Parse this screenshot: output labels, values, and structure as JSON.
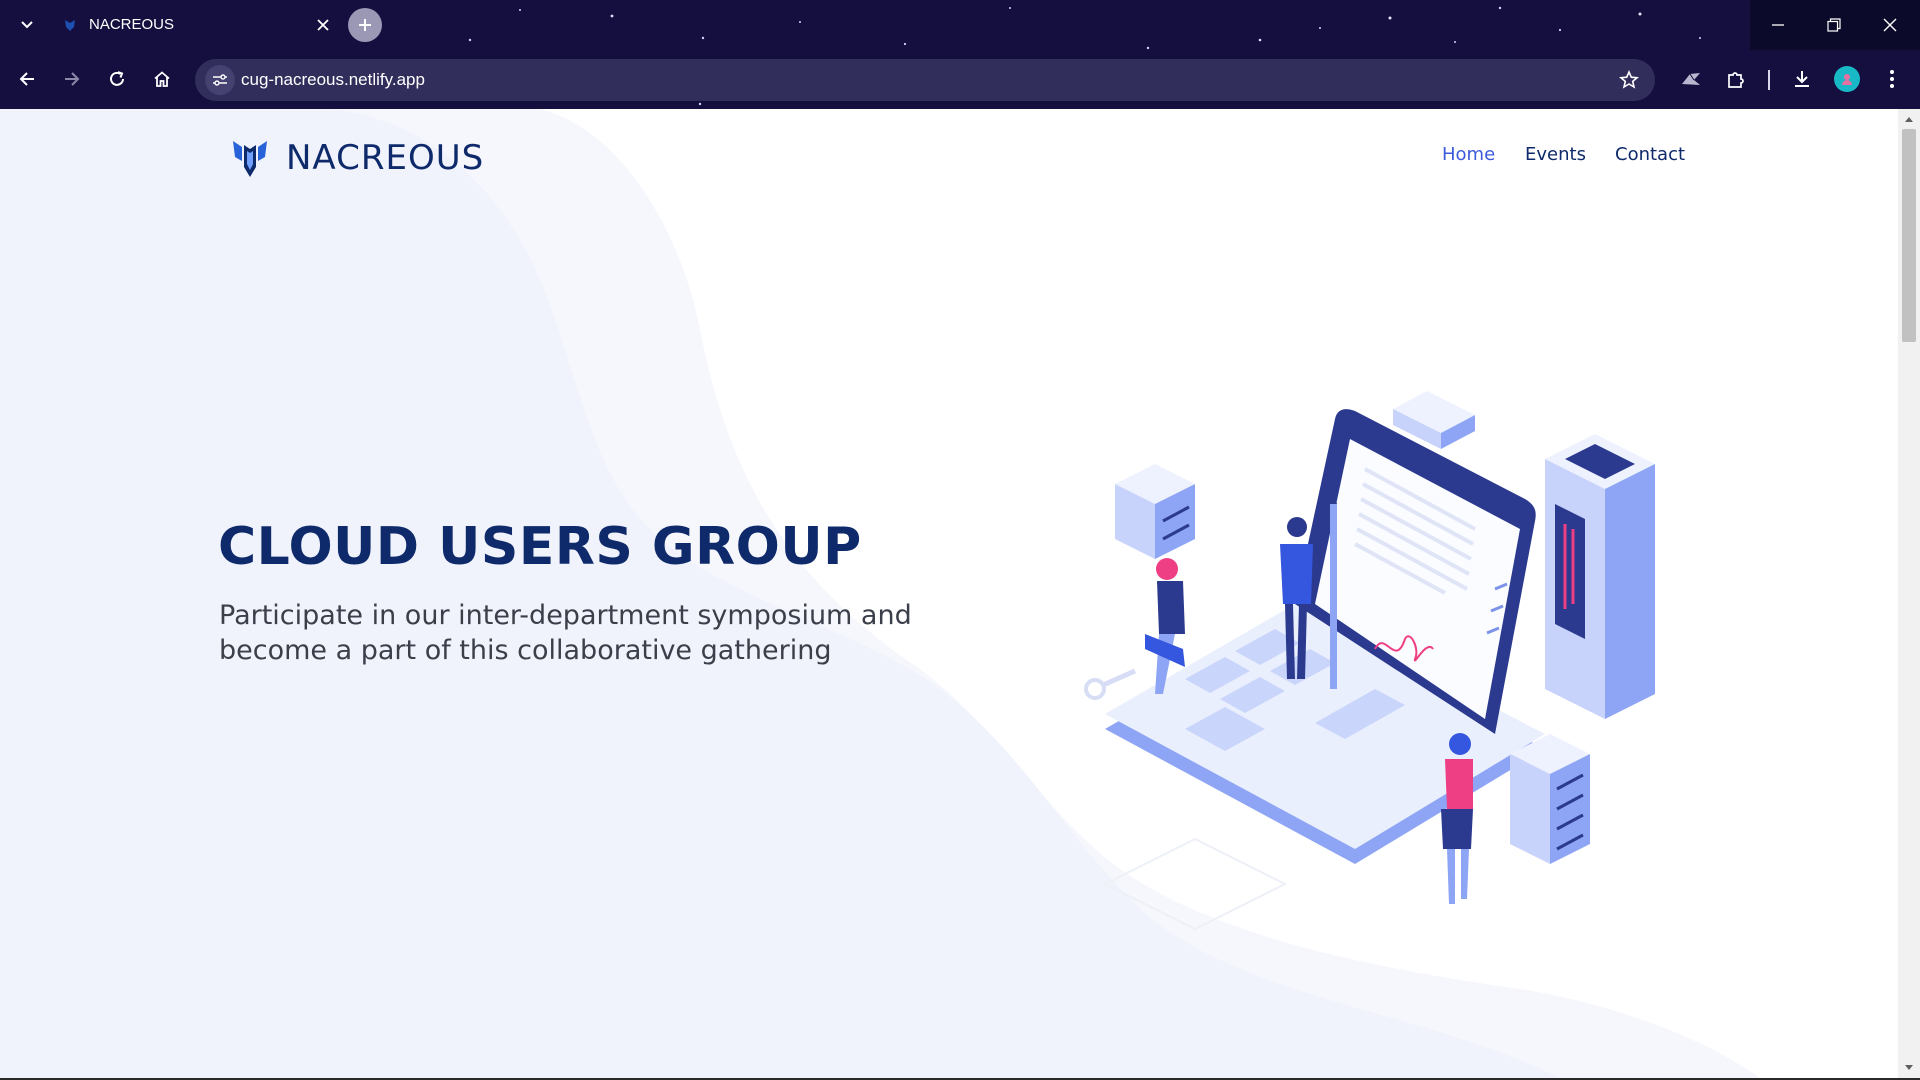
{
  "browser": {
    "tab_title": "NACREOUS",
    "url": "cug-nacreous.netlify.app",
    "colors": {
      "chrome_bg": "#140f3f",
      "omnibox_bg": "#322e5c",
      "profile": "#19b8c6"
    }
  },
  "site": {
    "brand": "NACREOUS",
    "nav": [
      {
        "label": "Home",
        "active": true
      },
      {
        "label": "Events",
        "active": false
      },
      {
        "label": "Contact",
        "active": false
      }
    ],
    "hero": {
      "title": "CLOUD USERS GROUP",
      "subtitle": "Participate in our inter-department symposium and become a part of this collaborative gathering"
    },
    "colors": {
      "primary_text": "#0e2a6b",
      "nav_active": "#3b5bdb",
      "illustration_blue": "#8ea5f5",
      "accent_pink": "#ee3f84"
    },
    "icons": [
      "nacreous-logo-icon",
      "laptop-illustration"
    ]
  }
}
